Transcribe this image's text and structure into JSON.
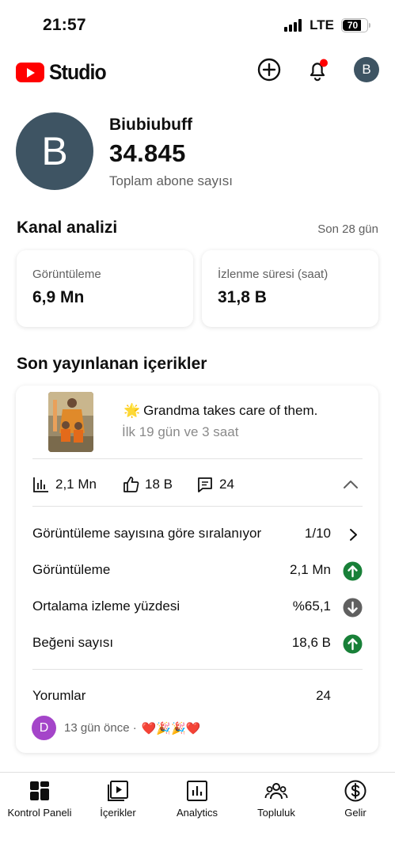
{
  "status_bar": {
    "time": "21:57",
    "network": "LTE",
    "battery": "70"
  },
  "header": {
    "logo_text": "Studio",
    "avatar_initial": "B"
  },
  "channel": {
    "avatar_initial": "B",
    "name": "Biubiubuff",
    "subscriber_count": "34.845",
    "subscriber_label": "Toplam abone sayısı"
  },
  "analytics": {
    "title": "Kanal analizi",
    "period": "Son 28 gün",
    "cards": [
      {
        "label": "Görüntüleme",
        "value": "6,9 Mn"
      },
      {
        "label": "İzlenme süresi (saat)",
        "value": "31,8 B"
      }
    ]
  },
  "recent": {
    "title": "Son yayınlanan içerikler",
    "video": {
      "title_emoji": "🌟",
      "title": "Grandma takes care of them.",
      "subtitle": "İlk 19 gün ve 3 saat",
      "views": "2,1 Mn",
      "likes": "18 B",
      "comments": "24"
    },
    "ranking": {
      "label": "Görüntüleme sayısına göre sıralanıyor",
      "value": "1/10"
    },
    "rows": [
      {
        "label": "Görüntüleme",
        "value": "2,1 Mn",
        "trend": "up"
      },
      {
        "label": "Ortalama izleme yüzdesi",
        "value": "%65,1",
        "trend": "down"
      },
      {
        "label": "Beğeni sayısı",
        "value": "18,6 B",
        "trend": "up"
      }
    ],
    "comments_row": {
      "label": "Yorumlar",
      "value": "24"
    },
    "latest_comment": {
      "avatar_initial": "D",
      "meta": "13 gün önce ·",
      "text": "❤️🎉🎉❤️"
    }
  },
  "bottom_nav": [
    {
      "label": "Kontrol Paneli",
      "icon": "dashboard-icon"
    },
    {
      "label": "İçerikler",
      "icon": "content-icon"
    },
    {
      "label": "Analytics",
      "icon": "analytics-icon"
    },
    {
      "label": "Topluluk",
      "icon": "community-icon"
    },
    {
      "label": "Gelir",
      "icon": "earn-icon"
    }
  ],
  "colors": {
    "brand_red": "#ff0000",
    "trend_up": "#188038",
    "trend_down": "#606060",
    "avatar": "#3e5463"
  }
}
